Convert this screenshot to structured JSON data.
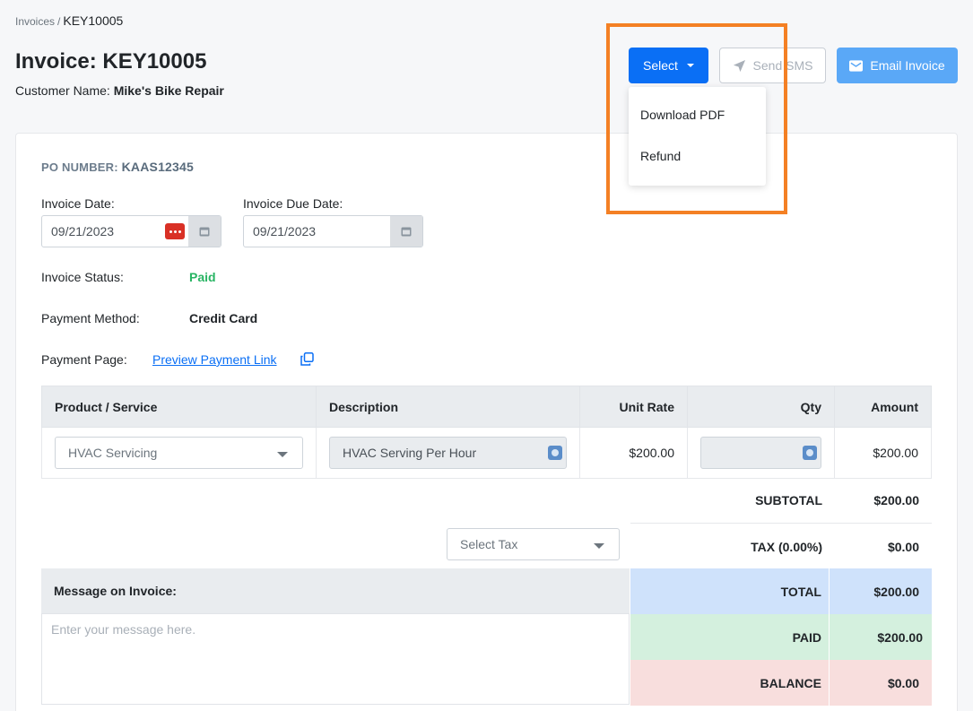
{
  "breadcrumb": {
    "parent": "Invoices",
    "separator": "/",
    "current": "KEY10005"
  },
  "header": {
    "title": "Invoice: KEY10005",
    "customer_label": "Customer Name:",
    "customer_name": "Mike's Bike Repair"
  },
  "actions": {
    "select_label": "Select",
    "send_sms_label": "Send SMS",
    "email_invoice_label": "Email Invoice",
    "dropdown_items": [
      "Download PDF",
      "Refund"
    ]
  },
  "invoice": {
    "po_label": "PO NUMBER:",
    "po_value": "KAAS12345",
    "date_label": "Invoice Date:",
    "date_value": "09/21/2023",
    "due_date_label": "Invoice Due Date:",
    "due_date_value": "09/21/2023",
    "status_label": "Invoice Status:",
    "status_value": "Paid",
    "method_label": "Payment Method:",
    "method_value": "Credit Card",
    "page_label": "Payment Page:",
    "page_link": "Preview Payment Link"
  },
  "table": {
    "headers": [
      "Product / Service",
      "Description",
      "Unit Rate",
      "Qty",
      "Amount"
    ],
    "rows": [
      {
        "product": "HVAC Servicing",
        "description": "HVAC Serving Per Hour",
        "unit_rate": "$200.00",
        "qty": "",
        "amount": "$200.00"
      }
    ]
  },
  "summary": {
    "subtotal_label": "SUBTOTAL",
    "subtotal_value": "$200.00",
    "tax_placeholder": "Select Tax",
    "tax_label": "TAX (0.00%)",
    "tax_value": "$0.00",
    "total_label": "TOTAL",
    "total_value": "$200.00",
    "paid_label": "PAID",
    "paid_value": "$200.00",
    "balance_label": "BALANCE",
    "balance_value": "$0.00"
  },
  "message": {
    "label": "Message on Invoice:",
    "placeholder": "Enter your message here."
  },
  "colors": {
    "primary": "#0a6ff5",
    "status_paid": "#28b463",
    "highlight": "#f48024"
  }
}
